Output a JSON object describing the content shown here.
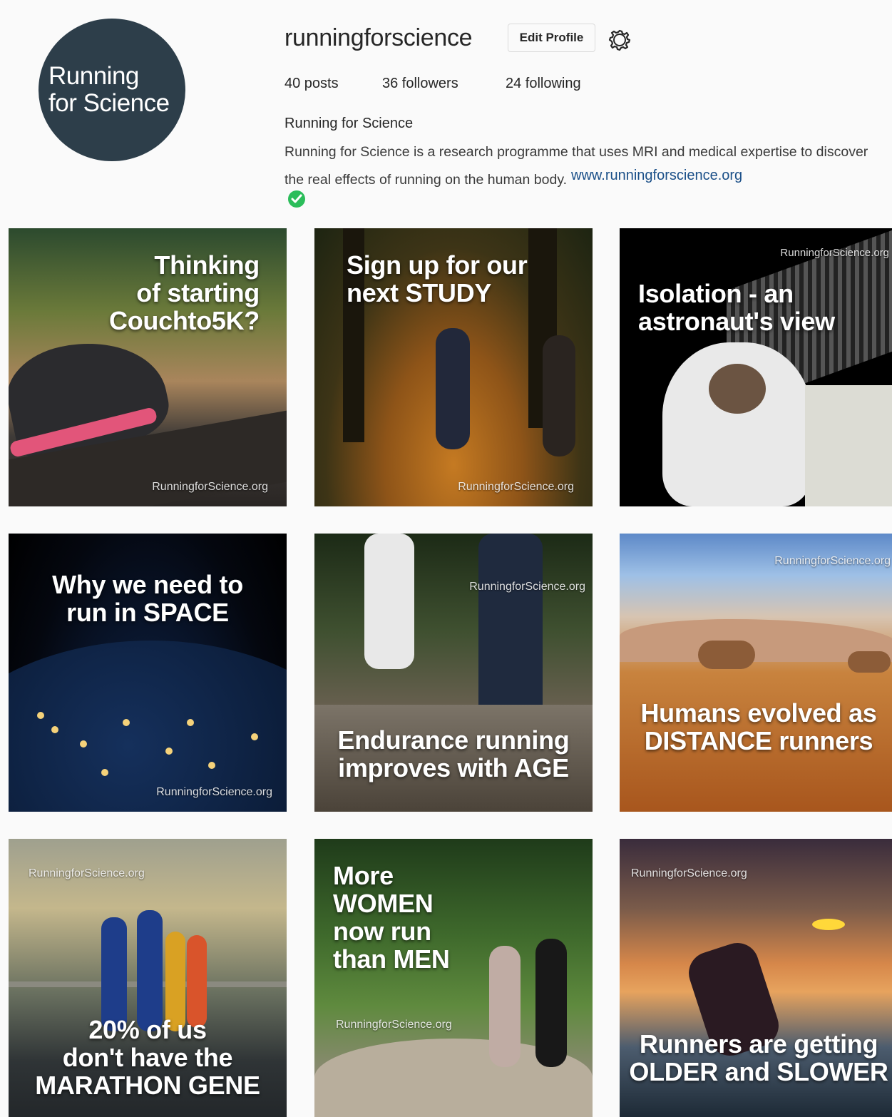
{
  "profile": {
    "avatar_line1": "Running",
    "avatar_line2": "for Science",
    "username": "runningforscience",
    "edit_label": "Edit Profile",
    "stats": {
      "posts": "40 posts",
      "followers": "36 followers",
      "following": "24 following"
    },
    "full_name": "Running for Science",
    "bio_text": "Running for Science is a research programme that uses MRI and medical expertise to discover the real effects of running on the human body.",
    "website": "www.runningforscience.org"
  },
  "colors": {
    "avatar_bg": "#2d3e4a",
    "link": "#1a4f88",
    "verified": "#2bbd5a"
  },
  "watermark": "RunningforScience.org",
  "posts": [
    {
      "lines": [
        "Thinking",
        "of starting",
        "Couchto5K?"
      ]
    },
    {
      "lines": [
        "Sign up for our",
        "next STUDY"
      ]
    },
    {
      "lines": [
        "Isolation - an",
        "astronaut's view"
      ]
    },
    {
      "lines": [
        "Why we need to",
        "run in SPACE"
      ]
    },
    {
      "lines": [
        "Endurance running",
        "improves with AGE"
      ]
    },
    {
      "lines": [
        "Humans evolved as",
        "DISTANCE runners"
      ]
    },
    {
      "lines": [
        "20% of us",
        "don't have the",
        "MARATHON GENE"
      ]
    },
    {
      "lines": [
        "More",
        "WOMEN",
        "now run",
        "than MEN"
      ]
    },
    {
      "lines": [
        "Runners are getting",
        "OLDER and SLOWER"
      ]
    }
  ]
}
